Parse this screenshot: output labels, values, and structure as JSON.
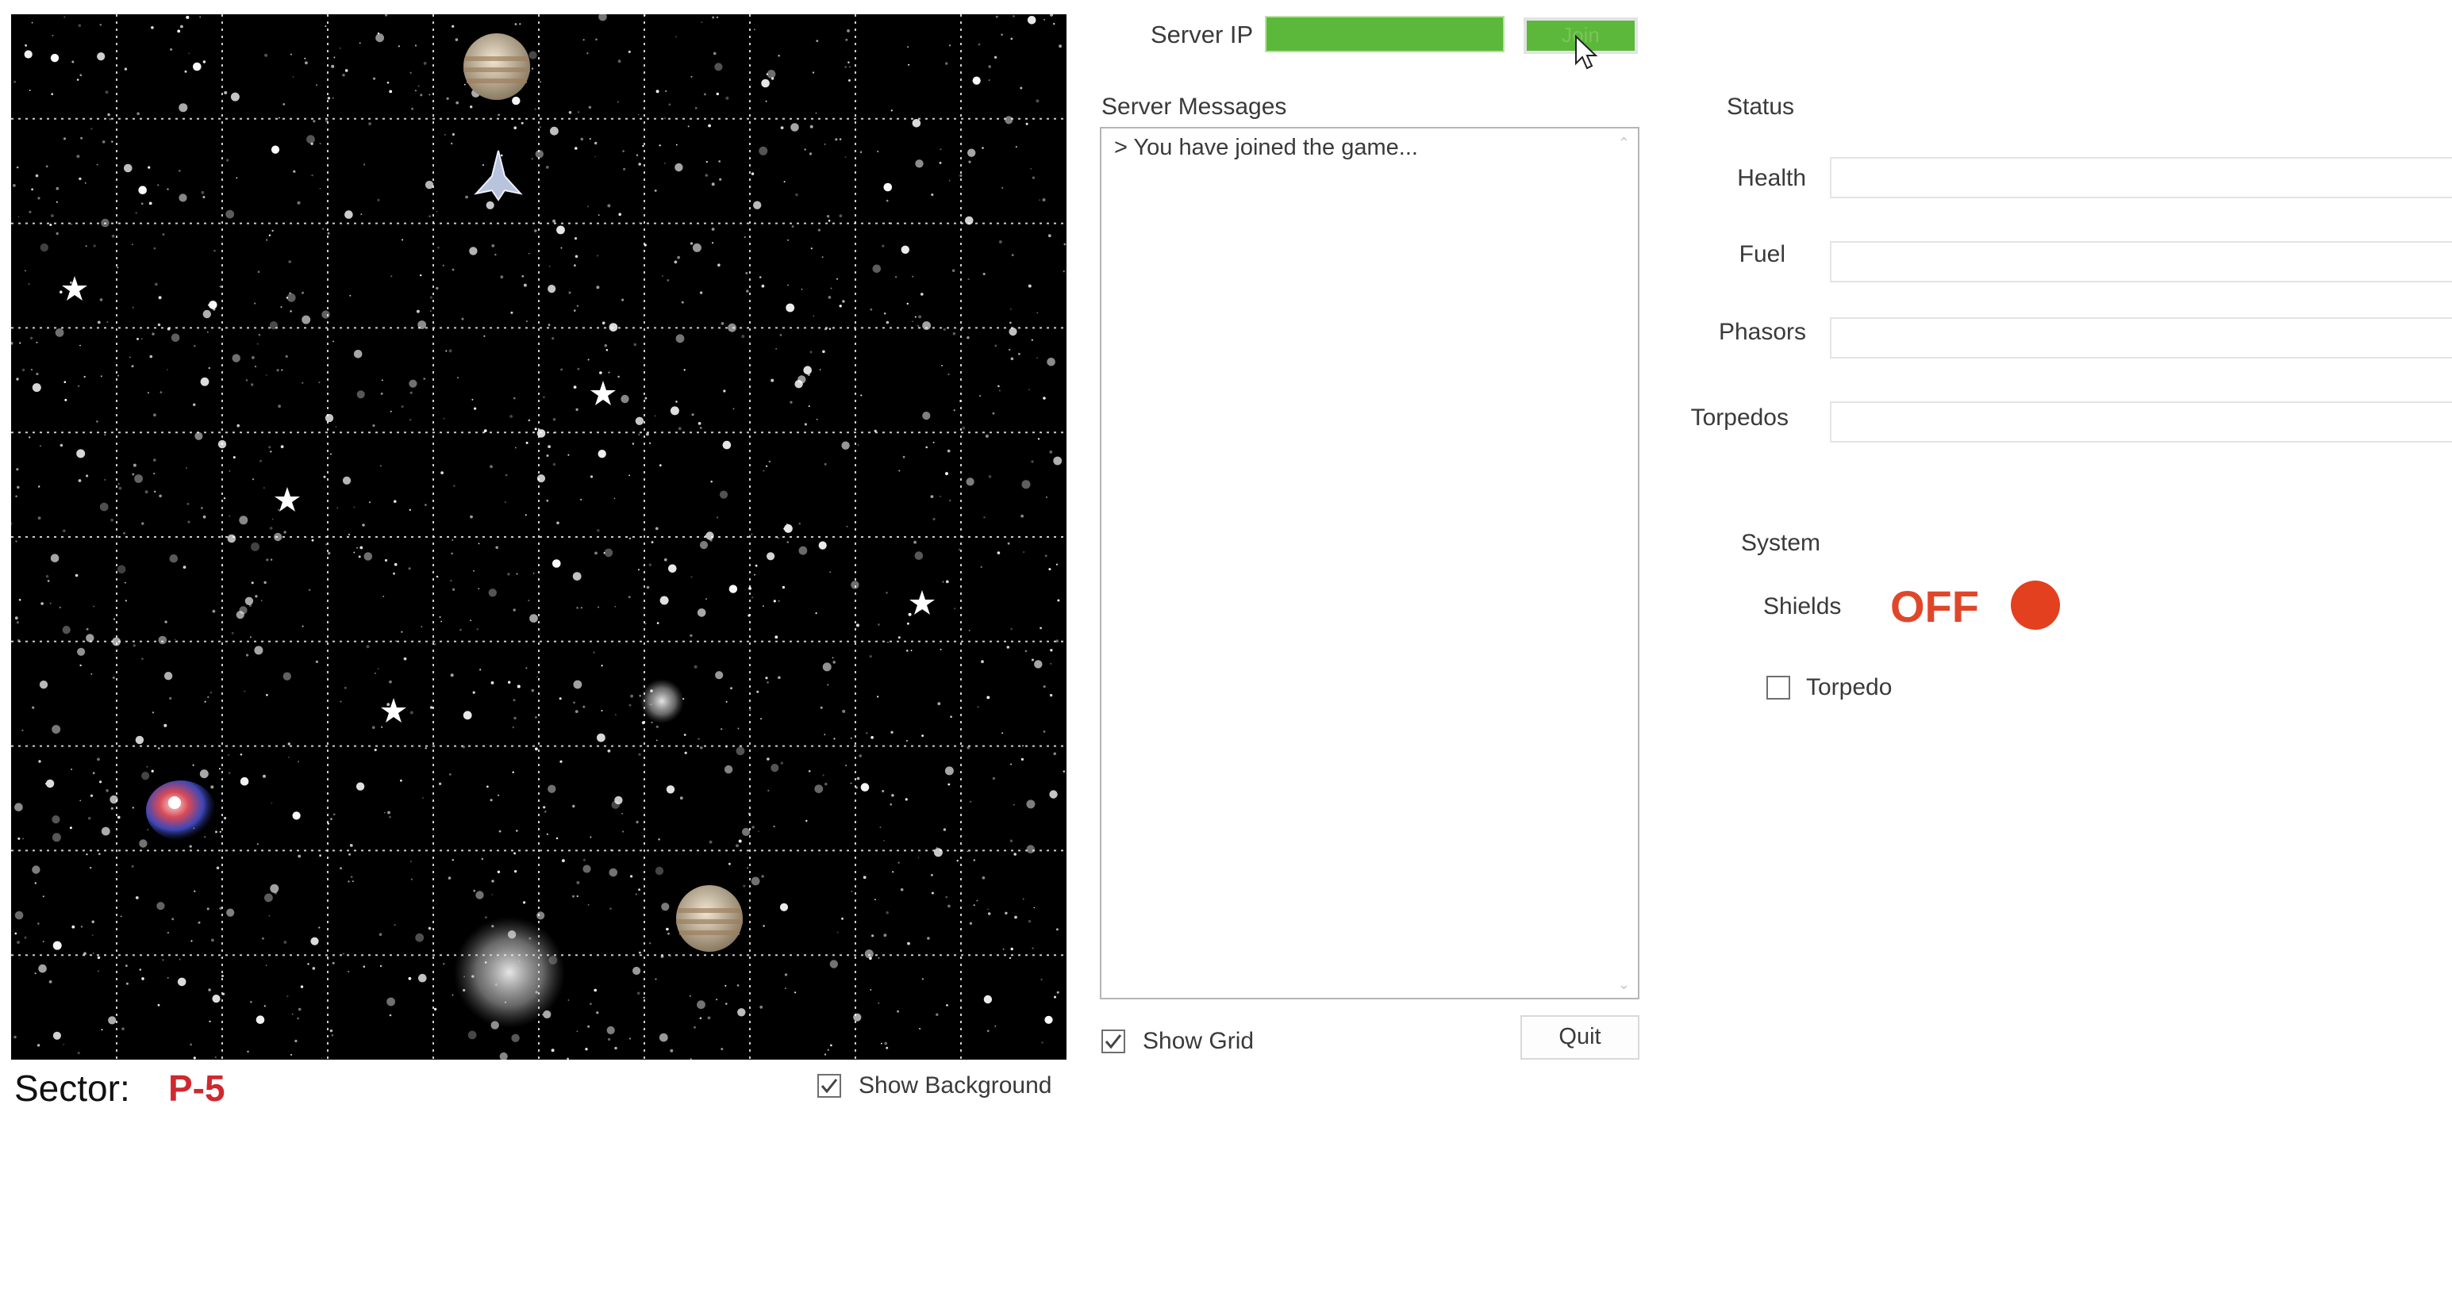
{
  "server": {
    "ip_label": "Server IP",
    "ip_value": "",
    "join_label": "Join"
  },
  "messages": {
    "title": "Server Messages",
    "lines": [
      "> You have joined the game..."
    ]
  },
  "map": {
    "sector_label": "Sector:",
    "sector_value": "P-5",
    "show_background": {
      "label": "Show Background",
      "checked": true
    },
    "show_grid": {
      "label": "Show Grid",
      "checked": true
    }
  },
  "quit_label": "Quit",
  "status": {
    "title": "Status",
    "health_label": "Health",
    "fuel_label": "Fuel",
    "phasors_label": "Phasors",
    "torpedos_label": "Torpedos"
  },
  "system": {
    "title": "System",
    "shields_label": "Shields",
    "shields_state": "OFF",
    "shields_indicator_color": "#e2401e",
    "torpedo": {
      "label": "Torpedo",
      "checked": false
    }
  },
  "colors": {
    "accent_green": "#5cb83a",
    "sector_red": "#d0282e",
    "off_red": "#e0472a"
  }
}
